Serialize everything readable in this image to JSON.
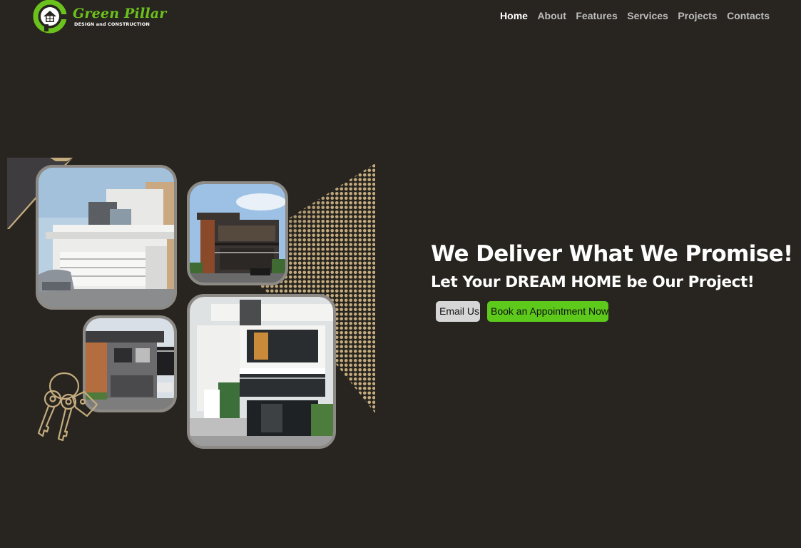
{
  "brand": {
    "name": "Green Pillar",
    "tagline": "DESIGN and CONSTRUCTION",
    "accent_color": "#6cc21c",
    "icon": "pillar-logo-icon"
  },
  "nav": {
    "items": [
      {
        "label": "Home",
        "active": true
      },
      {
        "label": "About",
        "active": false
      },
      {
        "label": "Features",
        "active": false
      },
      {
        "label": "Services",
        "active": false
      },
      {
        "label": "Projects",
        "active": false
      },
      {
        "label": "Contacts",
        "active": false
      }
    ]
  },
  "hero": {
    "headline": "We Deliver What We Promise!",
    "subheadline": "Let Your DREAM HOME be Our Project!",
    "buttons": {
      "email_label": "Email Us",
      "book_label": "Book an Appointment Now"
    },
    "colors": {
      "background": "#282520",
      "gold": "#c4ac7e",
      "button_green": "#5cc91b"
    }
  },
  "art": {
    "photos": [
      "house-photo-modern-gated",
      "house-photo-wood-facade",
      "house-photo-grey-villa",
      "house-photo-render-corner"
    ],
    "decor": [
      "gold-dot-halftone",
      "gold-corner-stripes",
      "house-keys-icon"
    ]
  }
}
